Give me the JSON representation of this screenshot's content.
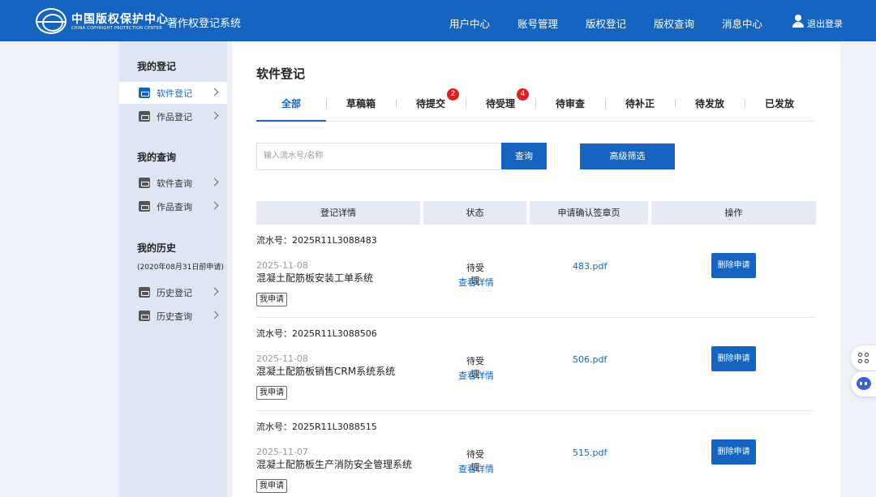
{
  "header": {
    "logo_cn": "中国版权保护中心",
    "logo_en": "CHINA COPYRIGHT PROTECTION CENTER",
    "system_title": "著作权登记系统",
    "nav": [
      "用户中心",
      "账号管理",
      "版权登记",
      "版权查询",
      "消息中心"
    ],
    "logout_label": "退出登录"
  },
  "sidebar": {
    "registration_heading": "我的登记",
    "registration_items": [
      "软件登记",
      "作品登记"
    ],
    "query_heading": "我的查询",
    "query_items": [
      "软件查询",
      "作品查询"
    ],
    "history_heading": "我的历史",
    "history_note": "(2020年08月31日前申请)",
    "history_items": [
      "历史登记",
      "历史查询"
    ]
  },
  "main": {
    "title": "软件登记",
    "tabs": [
      {
        "label": "全部"
      },
      {
        "label": "草稿箱"
      },
      {
        "label": "待提交",
        "badge": "2"
      },
      {
        "label": "待受理",
        "badge": "4"
      },
      {
        "label": "待审查"
      },
      {
        "label": "待补正"
      },
      {
        "label": "待发放"
      },
      {
        "label": "已发放"
      }
    ],
    "search_placeholder": "输入流水号/名称",
    "search_button": "查询",
    "filter_button": "高级筛选",
    "columns": [
      "登记详情",
      "状态",
      "申请确认签章页",
      "操作"
    ],
    "records": [
      {
        "serial": "流水号：2025R11L3088483",
        "date": "2025-11-08",
        "name": "混凝土配筋板安装工单系统",
        "tag": "我申请",
        "status": "待受理",
        "detail_link": "查看详情",
        "pdf": "483.pdf",
        "action": "删除申请"
      },
      {
        "serial": "流水号：2025R11L3088506",
        "date": "2025-11-08",
        "name": "混凝土配筋板销售CRM系统系统",
        "tag": "我申请",
        "status": "待受理",
        "detail_link": "查看详情",
        "pdf": "506.pdf",
        "action": "删除申请"
      },
      {
        "serial": "流水号：2025R11L3088515",
        "date": "2025-11-07",
        "name": "混凝土配筋板生产消防安全管理系统",
        "tag": "我申请",
        "status": "待受理",
        "detail_link": "查看详情",
        "pdf": "515.pdf",
        "action": "删除申请"
      }
    ]
  },
  "floating": {
    "icons": [
      "apps-icon",
      "robot-assistant-icon"
    ]
  },
  "colors": {
    "brand": "#1565c0",
    "badge": "#e02020",
    "sidebar_bg": "#dfe6f3",
    "page_bg": "#eef1f7"
  }
}
